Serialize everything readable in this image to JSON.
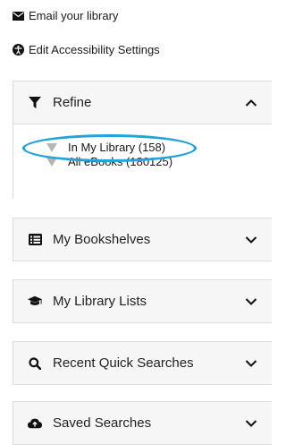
{
  "links": {
    "email_library": "Email your library",
    "edit_accessibility": "Edit Accessibility Settings"
  },
  "refine": {
    "title": "Refine",
    "facets": [
      {
        "label": "In My Library (158)"
      },
      {
        "label": "All eBooks (180125)"
      }
    ]
  },
  "panels": [
    {
      "title": "My Bookshelves",
      "icon": "list-icon"
    },
    {
      "title": "My Library Lists",
      "icon": "graduation-cap-icon"
    },
    {
      "title": "Recent Quick Searches",
      "icon": "search-icon"
    },
    {
      "title": "Saved Searches",
      "icon": "cloud-upload-icon"
    }
  ],
  "colors": {
    "panel_background": "#f6f6f6",
    "panel_border": "#dcdcdc",
    "highlight_ellipse": "#22a3dd",
    "facet_triangle": "#b5b5b5"
  }
}
